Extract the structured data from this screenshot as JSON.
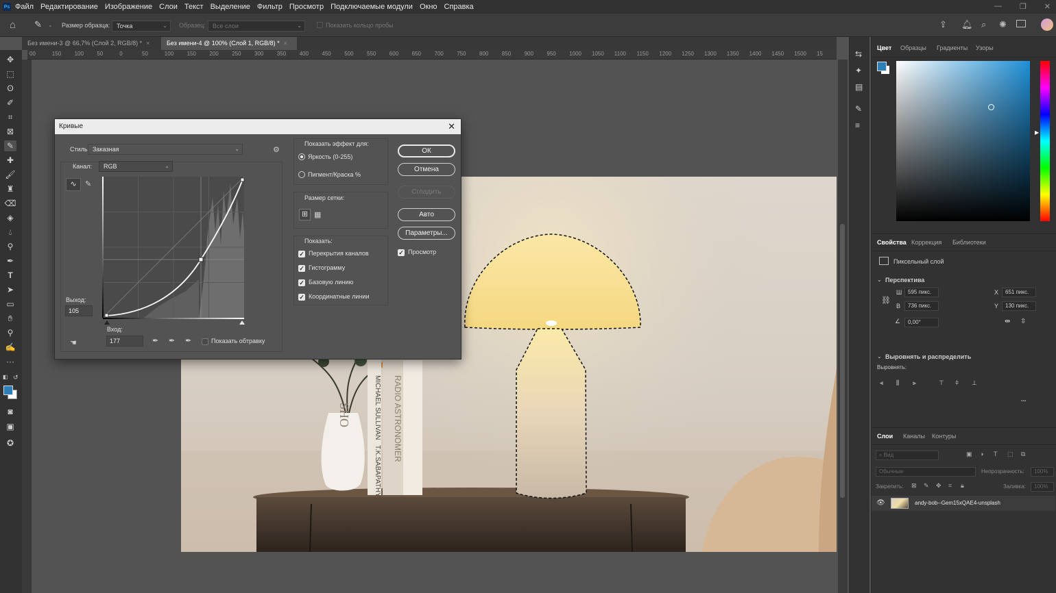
{
  "menubar": {
    "logo": "Ps",
    "items": [
      "Файл",
      "Редактирование",
      "Изображение",
      "Слои",
      "Текст",
      "Выделение",
      "Фильтр",
      "Просмотр",
      "Подключаемые модули",
      "Окно",
      "Справка"
    ]
  },
  "optionsbar": {
    "sample_size_label": "Размер образца:",
    "sample_size_value": "Точка",
    "sample_label": "Образец:",
    "sample_value": "Все слои",
    "show_ring_label": "Показать кольцо пробы"
  },
  "tabs": [
    {
      "label": "Без имени-3 @ 66,7% (Слой 2, RGB/8) *",
      "active": false
    },
    {
      "label": "Без имени-4 @ 100% (Слой 1, RGB/8) *",
      "active": true
    }
  ],
  "ruler_ticks": [
    "00",
    "150",
    "100",
    "50",
    "0",
    "50",
    "100",
    "150",
    "200",
    "250",
    "300",
    "350",
    "400",
    "450",
    "500",
    "550",
    "600",
    "650",
    "700",
    "750",
    "800",
    "850",
    "900",
    "950",
    "1000",
    "1050",
    "1100",
    "1150",
    "1200",
    "1250",
    "1300",
    "1350",
    "1400",
    "1450",
    "1500",
    "15"
  ],
  "dialog": {
    "title": "Кривые",
    "style_label": "Стиль:",
    "style_value": "Заказная",
    "channel_label": "Канал:",
    "channel_value": "RGB",
    "output_label": "Выход:",
    "output_value": "105",
    "input_label": "Вход:",
    "input_value": "177",
    "show_clipping_label": "Показать обтравку",
    "show_effect_label": "Показать эффект для:",
    "radio_light": "Яркость (0-255)",
    "radio_pigment": "Пигмент/Краска %",
    "grid_size_label": "Размер сетки:",
    "show_label": "Показать:",
    "checkboxes": [
      "Перекрытия каналов",
      "Гистограмму",
      "Базовую линию",
      "Координатные линии"
    ],
    "buttons": {
      "ok": "ОК",
      "cancel": "Отмена",
      "smooth": "Сгладить",
      "auto": "Авто",
      "options": "Параметры..."
    },
    "preview_label": "Просмотр"
  },
  "panels": {
    "color_tabs": [
      "Цвет",
      "Образцы",
      "Градиенты",
      "Узоры"
    ],
    "prop_tabs": [
      "Свойства",
      "Коррекция",
      "Библиотеки"
    ],
    "pixel_layer": "Пиксельный слой",
    "perspective": "Перспектива",
    "w_label": "Ш",
    "w_value": "595 пикс.",
    "x_label": "X",
    "x_value": "651 пикс.",
    "h_label": "В",
    "h_value": "736 пикс.",
    "y_label": "Y",
    "y_value": "130 пикс.",
    "angle_value": "0,00°",
    "align_distribute": "Выровнять и распределить",
    "align_label": "Выровнять:",
    "more": "...",
    "layer_tabs": [
      "Слои",
      "Каналы",
      "Контуры"
    ],
    "search_placeholder": "Вид",
    "blend_mode": "Обычные",
    "opacity_label": "Непрозрачность:",
    "opacity_value": "100%",
    "lock_label": "Закрепить:",
    "fill_label": "Заливка:",
    "fill_value": "100%",
    "layer_name": "andy-bob--Gem15xQAE4-unsplash"
  },
  "photo": {
    "book_text_1": "MICHAEL SULLIVAN",
    "book_text_2": "RADIO ASTRONOMER",
    "book_text_3": "T.K.SABAPATHY",
    "book_text_4": "SHO"
  },
  "colors": {
    "accent": "#31a8ff",
    "foreground_swatch": "#2e7fb8",
    "color_picker_hue": "#1e8fd6"
  }
}
